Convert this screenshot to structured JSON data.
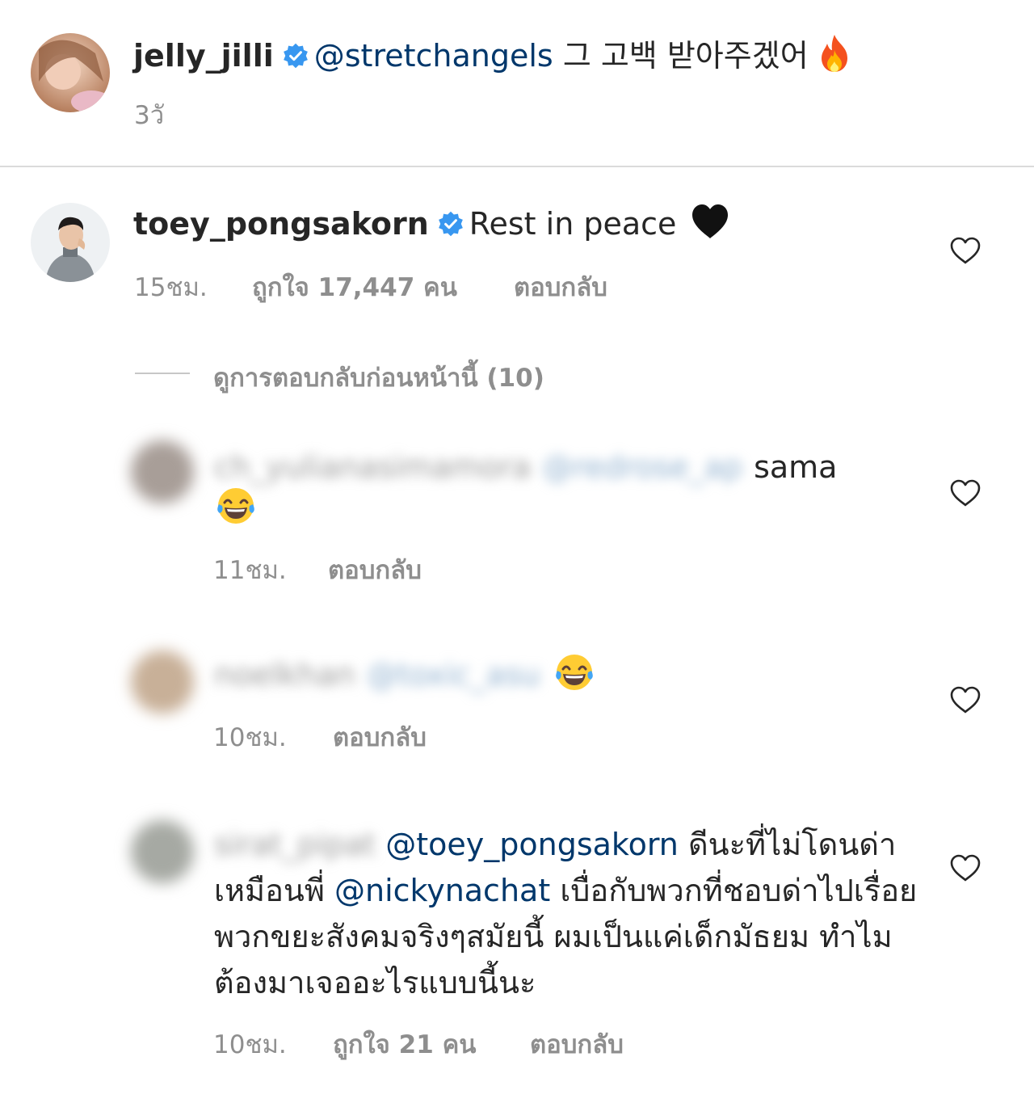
{
  "comment1": {
    "username": "jelly_jilli",
    "mention": "@stretchangels",
    "text": "그 고백 받아주겠어",
    "emoji": "fire-emoji",
    "time": "3วั"
  },
  "comment2": {
    "username": "toey_pongsakorn",
    "text": "Rest in peace",
    "emoji": "black-heart-emoji",
    "time": "15ชม.",
    "likes": "ถูกใจ 17,447 คน",
    "reply": "ตอบกลับ"
  },
  "view_previous": "ดูการตอบกลับก่อนหน้านี้ (10)",
  "reply1": {
    "username_blurred": "ch_yulianasimamora",
    "mention_blurred": "@redrose_ap",
    "text": "sama",
    "emoji": "tears-of-joy-emoji",
    "time": "11ชม.",
    "reply": "ตอบกลับ"
  },
  "reply2": {
    "username_blurred": "noelkhan",
    "mention_blurred": "@toxic_asu",
    "emoji": "tears-of-joy-emoji",
    "time": "10ชม.",
    "reply": "ตอบกลับ"
  },
  "reply3": {
    "username_blurred": "sirat_pipat",
    "mention1": "@toey_pongsakorn",
    "text1": " ดีนะที่ไม่โดนด่าเหมือนพี่ ",
    "mention2": "@nickynachat",
    "text2": " เบื่อกับพวกที่ชอบด่าไปเรื่อยพวกขยะสังคมจริงๆสมัยนี้ ผมเป็นแค่เด็กมัธยม ทำไมต้องมาเจออะไรแบบนี้นะ",
    "time": "10ชม.",
    "likes": "ถูกใจ 21 คน",
    "reply": "ตอบกลับ"
  },
  "colors": {
    "text": "#262626",
    "mention": "#00376b",
    "meta": "#8e8e8e",
    "verified": "#3897f0",
    "divider": "#dbdbdb"
  }
}
